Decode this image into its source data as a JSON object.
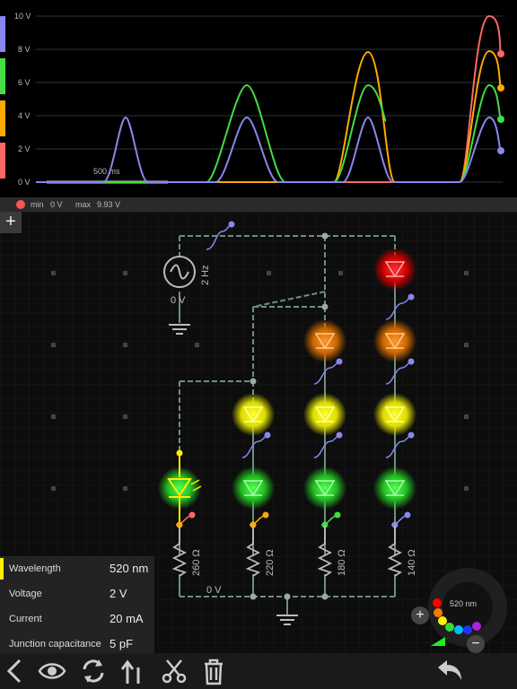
{
  "scope": {
    "y_ticks": [
      "10 V",
      "8 V",
      "6 V",
      "4 V",
      "2 V",
      "0 V"
    ],
    "time_label": "500 ms",
    "channel_colors": [
      "#8888ee",
      "#44dd44",
      "#ffaa00",
      "#ff6666"
    ]
  },
  "status": {
    "min_label": "min",
    "min_value": "0 V",
    "max_label": "max",
    "max_value": "9.93 V",
    "dot_color": "#ff5555"
  },
  "circuit": {
    "source_freq": "2 Hz",
    "source_voltage": "0 V",
    "ground_voltage": "0 V",
    "resistors": [
      "260 Ω",
      "220 Ω",
      "180 Ω",
      "140 Ω"
    ],
    "add_label": "+"
  },
  "properties": {
    "accent_color": "#ffee00",
    "rows": [
      {
        "label": "Wavelength",
        "value": "520 nm"
      },
      {
        "label": "Voltage",
        "value": "2 V"
      },
      {
        "label": "Current",
        "value": "20 mA"
      },
      {
        "label": "Junction capacitance",
        "value": "5 pF"
      }
    ]
  },
  "picker": {
    "wavelength": "520 nm",
    "plus": "+",
    "minus": "−"
  },
  "toolbar": {
    "icons": [
      "back-icon",
      "eye-icon",
      "rotate-icon",
      "flip-icon",
      "cut-icon",
      "trash-icon",
      "undo-icon"
    ]
  }
}
